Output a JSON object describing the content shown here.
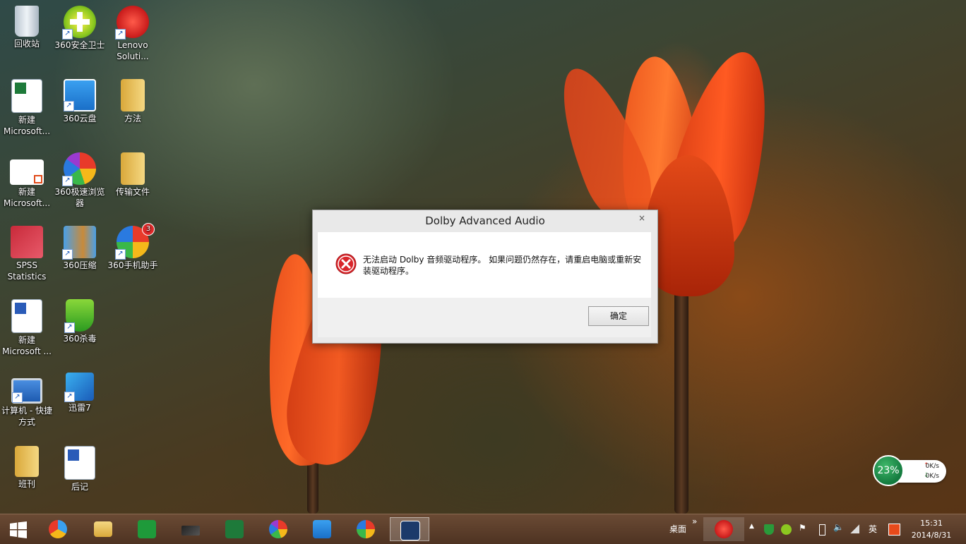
{
  "desktop": {
    "icons": [
      {
        "label": "回收站"
      },
      {
        "label": "360安全卫士"
      },
      {
        "label": "Lenovo Soluti..."
      },
      {
        "label": "新建 Microsoft..."
      },
      {
        "label": "360云盘"
      },
      {
        "label": "方法"
      },
      {
        "label": "新建 Microsoft..."
      },
      {
        "label": "360极速浏览器"
      },
      {
        "label": "传输文件"
      },
      {
        "label": "SPSS Statistics"
      },
      {
        "label": "360压缩"
      },
      {
        "label": "360手机助手"
      },
      {
        "label": "新建 Microsoft ..."
      },
      {
        "label": "360杀毒"
      },
      {
        "label": "计算机 - 快捷方式"
      },
      {
        "label": "迅雷7"
      },
      {
        "label": "班刊"
      },
      {
        "label": "后记"
      }
    ],
    "badge_count": "3"
  },
  "dialog": {
    "title": "Dolby Advanced Audio",
    "close_glyph": "×",
    "message": "无法启动 Dolby 音频驱动程序。 如果问题仍然存在，请重启电脑或重新安装驱动程序。",
    "ok_label": "确定"
  },
  "widget": {
    "percent": "23%",
    "up_speed": "0K/s",
    "down_speed": "0K/s"
  },
  "taskbar": {
    "desktop_label": "桌面",
    "expand_glyph": "»",
    "ime": "英",
    "time": "15:31",
    "date": "2014/8/31"
  },
  "colors": {
    "error_red": "#d9262b",
    "dialog_bg": "#e9e9e9",
    "taskbar": "#5a3c28"
  }
}
